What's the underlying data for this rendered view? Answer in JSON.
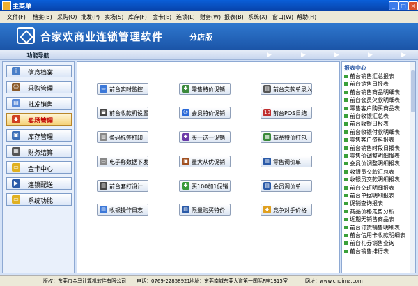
{
  "window": {
    "title": "主菜单"
  },
  "menubar": {
    "items": [
      "文件(F)",
      "档案(B)",
      "采购(O)",
      "批发(P)",
      "卖场(S)",
      "库存(F)",
      "金卡(E)",
      "连锁(L)",
      "财务(W)",
      "报表(B)",
      "系统(X)",
      "窗口(W)",
      "帮助(H)"
    ]
  },
  "banner": {
    "brand": "合家欢商业连锁管理软件",
    "edition": "分店版"
  },
  "nav": {
    "header": "功能导航",
    "items": [
      {
        "label": "信息档案",
        "icon": "info-icon"
      },
      {
        "label": "采购管理",
        "icon": "purchase-icon"
      },
      {
        "label": "批发销售",
        "icon": "wholesale-icon"
      },
      {
        "label": "卖场管理",
        "icon": "store-icon"
      },
      {
        "label": "库存管理",
        "icon": "inventory-icon"
      },
      {
        "label": "财务结算",
        "icon": "finance-icon"
      },
      {
        "label": "金卡中心",
        "icon": "card-icon"
      },
      {
        "label": "连锁配送",
        "icon": "delivery-icon"
      },
      {
        "label": "系统功能",
        "icon": "system-icon"
      }
    ]
  },
  "main": {
    "buttons": [
      [
        "前台实时监控",
        "零售特价促销",
        "前台交款单录入"
      ],
      [
        "前台收款机设置",
        "会员特价促销",
        "前台POS日结"
      ],
      [
        "条码标签打印",
        "买一送一促销",
        "商品特价打包"
      ],
      [
        "电子称数据下发",
        "量大从优促销",
        "零售调价单"
      ],
      [
        "前台套打设计",
        "买100加1促销",
        "会员调价单"
      ],
      [
        "收银操作日志",
        "限量购买特价",
        "竞争对手价格"
      ]
    ]
  },
  "report": {
    "title": "报表中心",
    "items": [
      "前台销售汇总报表",
      "前台销售日报表",
      "前台销售商品明细表",
      "前台会员欠款明细表",
      "零售客户购买商品表",
      "前台收银汇总表",
      "前台收银日报表",
      "前台收银付款明细表",
      "零售客户资料报表",
      "前台销售时段日报表",
      "零售价调整明细报表",
      "会员价调整明细报表",
      "收银员交款汇总表",
      "收银员交款明细报表",
      "前台交班明细报表",
      "前台单据明细报表",
      "促销查询报表",
      "商品价格走势分析",
      "近期无销售商品表",
      "前台订货销售明细表",
      "前台信用卡收款明细表",
      "前台礼券销售查询",
      "前台销售排行表"
    ]
  },
  "status": {
    "company": "版权：东莞市金马计算机软件有限公司",
    "phone": "电话：0769-22858921",
    "address": "地址：东莞南城东莞大道第一国际F座1315室",
    "website": "网址：www.cnqima.com"
  },
  "colors": {
    "accent": "#1b55a8",
    "active": "#f5d27a",
    "link": "#1f4fa0"
  }
}
